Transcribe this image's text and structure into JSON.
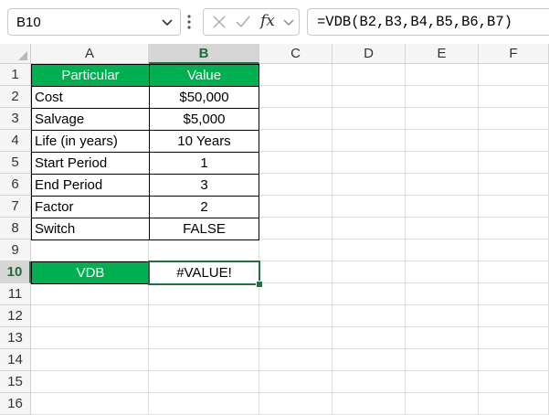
{
  "formula_bar": {
    "name_box": "B10",
    "formula": "=VDB(B2,B3,B4,B5,B6,B7)",
    "fx_label": "fx"
  },
  "columns": [
    "A",
    "B",
    "C",
    "D",
    "E",
    "F"
  ],
  "rows": [
    "1",
    "2",
    "3",
    "4",
    "5",
    "6",
    "7",
    "8",
    "9",
    "10",
    "11",
    "12",
    "13",
    "14",
    "15",
    "16"
  ],
  "table": {
    "header": {
      "particular": "Particular",
      "value": "Value"
    },
    "items": [
      {
        "label": "Cost",
        "value": "$50,000"
      },
      {
        "label": "Salvage",
        "value": "$5,000"
      },
      {
        "label": "Life (in years)",
        "value": "10 Years"
      },
      {
        "label": "Start Period",
        "value": "1"
      },
      {
        "label": "End Period",
        "value": "3"
      },
      {
        "label": "Factor",
        "value": "2"
      },
      {
        "label": "Switch",
        "value": "FALSE"
      }
    ],
    "result": {
      "label": "VDB",
      "value": "#VALUE!"
    }
  },
  "colors": {
    "header_green": "#00b050",
    "selection": "#1e7145"
  },
  "icons": [
    "chevron-down-icon",
    "more-vert-icon",
    "cancel-icon",
    "enter-icon",
    "fx-icon",
    "chevron-down-icon"
  ]
}
